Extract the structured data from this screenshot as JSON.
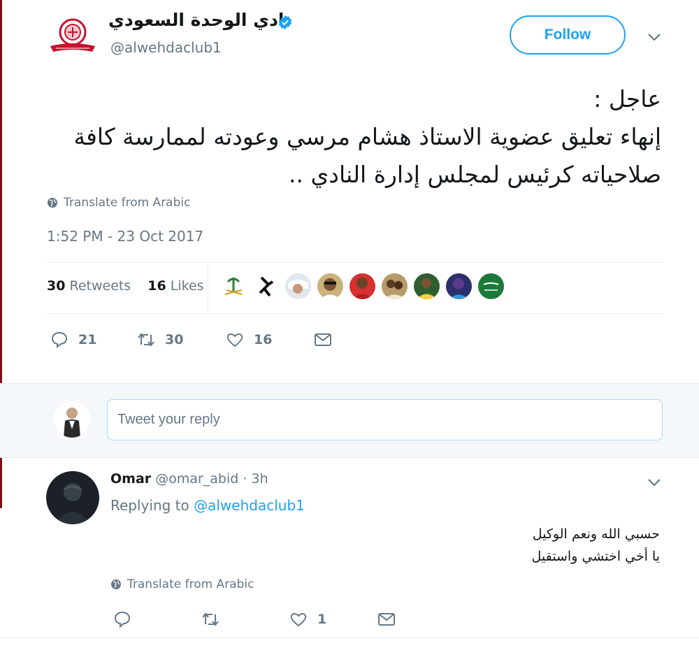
{
  "header": {
    "name": "نادي الوحدة السعودي",
    "handle": "@alwehdaclub1",
    "follow_label": "Follow",
    "verified_icon": "verified-badge-icon",
    "accent": "#1da1f2"
  },
  "tweet": {
    "text": "عاجل :\nإنهاء تعليق عضوية الاستاذ هشام مرسي وعودته لممارسة كافة صلاحياته كرئيس لمجلس إدارة النادي ..",
    "translate_label": "Translate from Arabic",
    "timestamp": "1:52 PM - 23 Oct 2017",
    "retweets_count": "30",
    "retweets_label": "Retweets",
    "likes_count": "16",
    "likes_label": "Likes",
    "actions": {
      "reply_count": "21",
      "retweet_count": "30",
      "like_count": "16"
    }
  },
  "reply_box": {
    "placeholder": "Tweet your reply"
  },
  "reply": {
    "name": "Omar",
    "handle": "@omar_abid",
    "separator": "·",
    "time": "3h",
    "replying_prefix": "Replying to",
    "replying_to": "@alwehdaclub1",
    "text": "حسبي الله ونعم الوكيل\nيا أخي اختشي واستقيل",
    "translate_label": "Translate from Arabic",
    "like_count": "1"
  }
}
